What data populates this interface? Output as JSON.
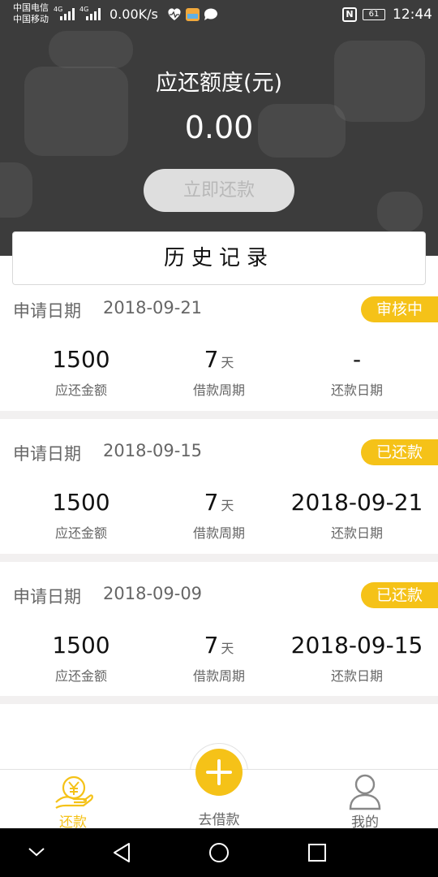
{
  "status_bar": {
    "carrier_1": "中国电信",
    "carrier_2": "中国移动",
    "net_1": "4G",
    "net_2": "4G",
    "speed": "0.00K/s",
    "battery": "61",
    "time": "12:44",
    "icons": [
      "heart-rate-icon",
      "app-notification-icon",
      "chat-bubble-icon",
      "nfc-icon",
      "battery-icon"
    ]
  },
  "header": {
    "title": "应还额度(元)",
    "amount": "0.00",
    "repay_button": "立即还款"
  },
  "history": {
    "title": "历史记录"
  },
  "records": [
    {
      "apply_label": "申请日期",
      "apply_date": "2018-09-21",
      "status": "审核中",
      "amount": "1500",
      "amount_label": "应还金额",
      "period": "7",
      "period_unit": "天",
      "period_label": "借款周期",
      "repay_date": "-",
      "repay_date_label": "还款日期"
    },
    {
      "apply_label": "申请日期",
      "apply_date": "2018-09-15",
      "status": "已还款",
      "amount": "1500",
      "amount_label": "应还金额",
      "period": "7",
      "period_unit": "天",
      "period_label": "借款周期",
      "repay_date": "2018-09-21",
      "repay_date_label": "还款日期"
    },
    {
      "apply_label": "申请日期",
      "apply_date": "2018-09-09",
      "status": "已还款",
      "amount": "1500",
      "amount_label": "应还金额",
      "period": "7",
      "period_unit": "天",
      "period_label": "借款周期",
      "repay_date": "2018-09-15",
      "repay_date_label": "还款日期"
    }
  ],
  "bottom_nav": {
    "items": [
      {
        "label": "还款",
        "icon": "yen-hand-icon",
        "active": true
      },
      {
        "label": "去借款",
        "icon": "plus-icon",
        "active": false
      },
      {
        "label": "我的",
        "icon": "user-icon",
        "active": false
      }
    ]
  },
  "colors": {
    "accent": "#f5c218",
    "header_bg": "#3c3c3c",
    "text_primary": "#111111",
    "text_secondary": "#666666",
    "separator": "#f2f0f0"
  }
}
